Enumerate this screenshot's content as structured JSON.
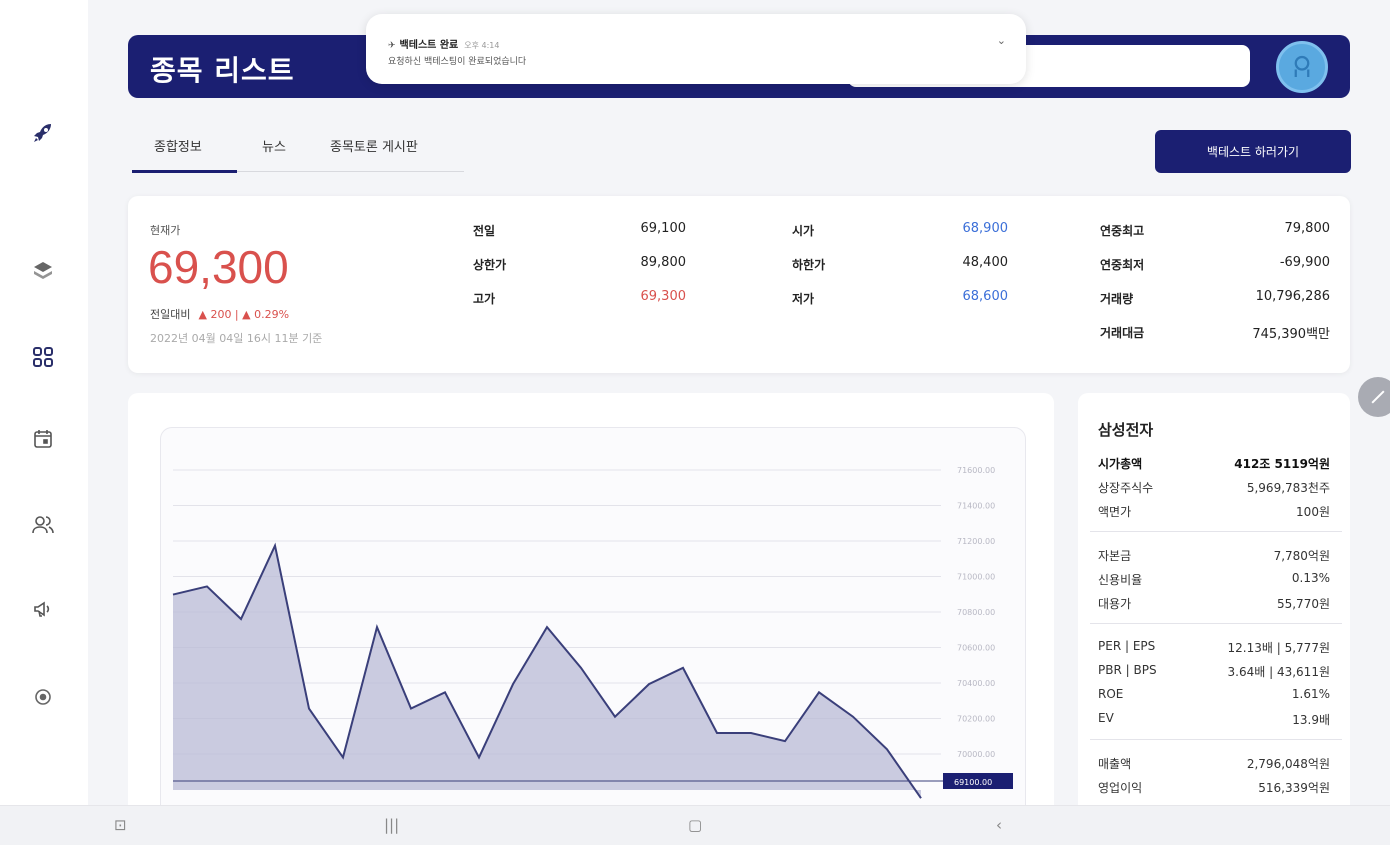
{
  "header": {
    "title": "종목 리스트",
    "search_value": ""
  },
  "toast": {
    "title": "백테스트 완료",
    "time": "오후 4:14",
    "message": "요청하신 백테스팅이 완료되었습니다"
  },
  "tabs": [
    {
      "label": "종합정보",
      "active": true
    },
    {
      "label": "뉴스",
      "active": false
    },
    {
      "label": "종목토론 게시판",
      "active": false
    }
  ],
  "backtest_button": "백테스트 하러가기",
  "price": {
    "current_label": "현재가",
    "current": "69,300",
    "change_label": "전일대비",
    "change": "▲ 200 | ▲ 0.29%",
    "timestamp": "2022년 04월 04일 16시 11분 기준"
  },
  "stats": [
    {
      "label": "전일",
      "value": "69,100",
      "color": "#222222"
    },
    {
      "label": "상한가",
      "value": "89,800",
      "color": "#222222"
    },
    {
      "label": "고가",
      "value": "69,300",
      "color": "#d9514d"
    },
    {
      "label": "시가",
      "value": "68,900",
      "color": "#3b6fd8"
    },
    {
      "label": "하한가",
      "value": "48,400",
      "color": "#222222"
    },
    {
      "label": "저가",
      "value": "68,600",
      "color": "#3b6fd8"
    },
    {
      "label": "연중최고",
      "value": "79,800",
      "color": "#222222"
    },
    {
      "label": "연중최저",
      "value": "-69,900",
      "color": "#222222"
    },
    {
      "label": "거래량",
      "value": "10,796,286",
      "color": "#222222"
    },
    {
      "label": "거래대금",
      "value": "745,390백만",
      "color": "#222222"
    }
  ],
  "chart_data": {
    "type": "area",
    "values": [
      70900,
      70950,
      70750,
      71200,
      70200,
      69900,
      70700,
      70200,
      70300,
      69900,
      70350,
      70700,
      70450,
      70150,
      70350,
      70450,
      70050,
      70050,
      70000,
      70300,
      70150,
      69950,
      69650
    ],
    "yticks": [
      "71600.00",
      "71400.00",
      "71200.00",
      "71000.00",
      "70800.00",
      "70600.00",
      "70400.00",
      "70200.00",
      "70000.00"
    ],
    "ylim": [
      69700,
      71800
    ],
    "current_label": "69100.00",
    "colors": {
      "line": "#3a3f7a",
      "fill": "#b9bbd6"
    }
  },
  "info": {
    "company": "삼성전자",
    "groups": [
      [
        {
          "label": "시가총액",
          "value": "412조 5119억원",
          "bold": true
        },
        {
          "label": "상장주식수",
          "value": "5,969,783천주",
          "bold": false
        },
        {
          "label": "액면가",
          "value": "100원",
          "bold": false
        }
      ],
      [
        {
          "label": "자본금",
          "value": "7,780억원",
          "bold": false
        },
        {
          "label": "신용비율",
          "value": "0.13%",
          "bold": false
        },
        {
          "label": "대용가",
          "value": "55,770원",
          "bold": false
        }
      ],
      [
        {
          "label": "PER | EPS",
          "value": "12.13배 | 5,777원",
          "bold": false
        },
        {
          "label": "PBR | BPS",
          "value": "3.64배 | 43,611원",
          "bold": false
        },
        {
          "label": "ROE",
          "value": "1.61%",
          "bold": false
        },
        {
          "label": "EV",
          "value": "13.9배",
          "bold": false
        }
      ],
      [
        {
          "label": "매출액",
          "value": "2,796,048억원",
          "bold": false
        },
        {
          "label": "영업이익",
          "value": "516,339억원",
          "bold": false
        }
      ]
    ]
  },
  "icons": {
    "sidebar": [
      "rocket-icon",
      "layers-icon",
      "grid-icon",
      "calendar-icon",
      "users-icon",
      "megaphone-icon",
      "target-icon"
    ]
  }
}
